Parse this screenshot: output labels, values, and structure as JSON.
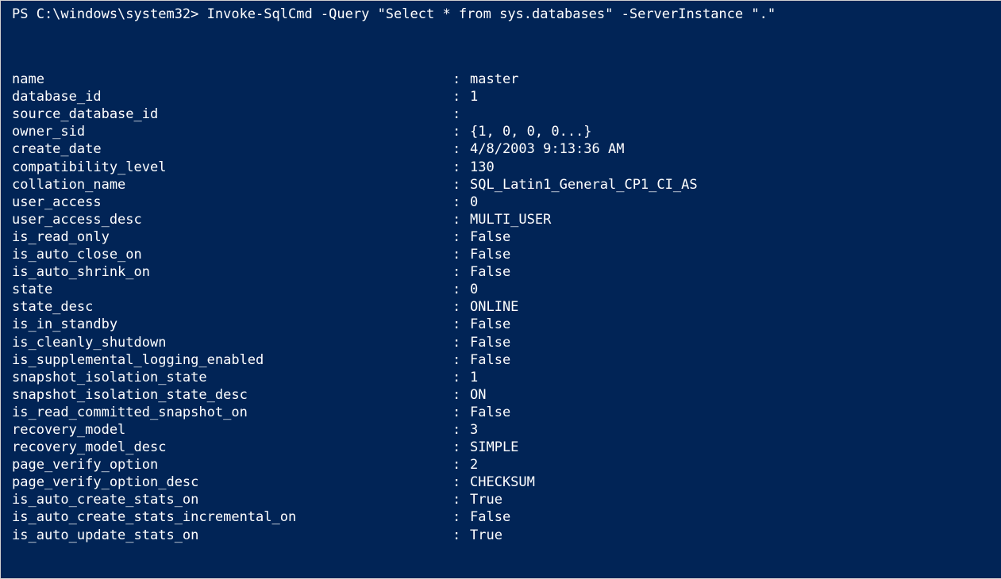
{
  "prompt": "PS C:\\windows\\system32> Invoke-SqlCmd -Query \"Select * from sys.databases\" -ServerInstance \".\"",
  "separator": ":",
  "rows": [
    {
      "key": "name",
      "value": "master"
    },
    {
      "key": "database_id",
      "value": "1"
    },
    {
      "key": "source_database_id",
      "value": ""
    },
    {
      "key": "owner_sid",
      "value": "{1, 0, 0, 0...}"
    },
    {
      "key": "create_date",
      "value": "4/8/2003 9:13:36 AM"
    },
    {
      "key": "compatibility_level",
      "value": "130"
    },
    {
      "key": "collation_name",
      "value": "SQL_Latin1_General_CP1_CI_AS"
    },
    {
      "key": "user_access",
      "value": "0"
    },
    {
      "key": "user_access_desc",
      "value": "MULTI_USER"
    },
    {
      "key": "is_read_only",
      "value": "False"
    },
    {
      "key": "is_auto_close_on",
      "value": "False"
    },
    {
      "key": "is_auto_shrink_on",
      "value": "False"
    },
    {
      "key": "state",
      "value": "0"
    },
    {
      "key": "state_desc",
      "value": "ONLINE"
    },
    {
      "key": "is_in_standby",
      "value": "False"
    },
    {
      "key": "is_cleanly_shutdown",
      "value": "False"
    },
    {
      "key": "is_supplemental_logging_enabled",
      "value": "False"
    },
    {
      "key": "snapshot_isolation_state",
      "value": "1"
    },
    {
      "key": "snapshot_isolation_state_desc",
      "value": "ON"
    },
    {
      "key": "is_read_committed_snapshot_on",
      "value": "False"
    },
    {
      "key": "recovery_model",
      "value": "3"
    },
    {
      "key": "recovery_model_desc",
      "value": "SIMPLE"
    },
    {
      "key": "page_verify_option",
      "value": "2"
    },
    {
      "key": "page_verify_option_desc",
      "value": "CHECKSUM"
    },
    {
      "key": "is_auto_create_stats_on",
      "value": "True"
    },
    {
      "key": "is_auto_create_stats_incremental_on",
      "value": "False"
    },
    {
      "key": "is_auto_update_stats_on",
      "value": "True"
    }
  ]
}
